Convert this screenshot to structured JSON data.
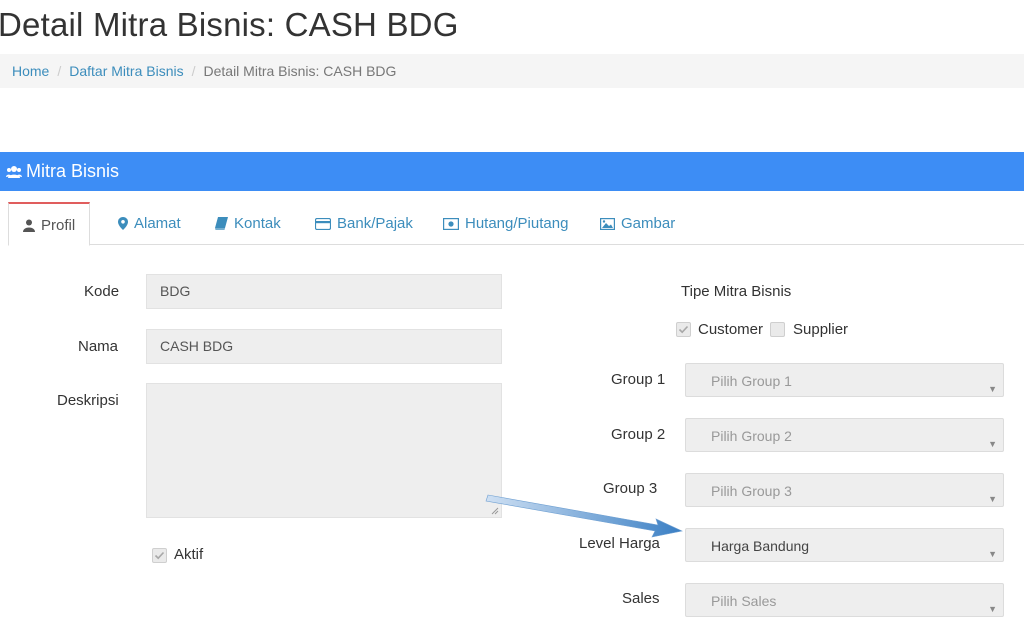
{
  "page": {
    "title": "Detail Mitra Bisnis: CASH BDG"
  },
  "breadcrumb": {
    "items": [
      {
        "label": "Home"
      },
      {
        "label": "Daftar Mitra Bisnis"
      },
      {
        "label": "Detail Mitra Bisnis: CASH BDG"
      }
    ],
    "separator": "/"
  },
  "panel": {
    "title": "Mitra Bisnis",
    "icon": "users-icon",
    "header_color": "#3d8df5"
  },
  "tabs": [
    {
      "label": "Profil",
      "icon": "user-icon",
      "active": true
    },
    {
      "label": "Alamat",
      "icon": "map-marker-icon",
      "active": false
    },
    {
      "label": "Kontak",
      "icon": "book-icon",
      "active": false
    },
    {
      "label": "Bank/Pajak",
      "icon": "credit-card-icon",
      "active": false
    },
    {
      "label": "Hutang/Piutang",
      "icon": "money-icon",
      "active": false
    },
    {
      "label": "Gambar",
      "icon": "image-icon",
      "active": false
    }
  ],
  "form": {
    "kode": {
      "label": "Kode",
      "value": "BDG"
    },
    "nama": {
      "label": "Nama",
      "value": "CASH BDG"
    },
    "deskripsi": {
      "label": "Deskripsi",
      "value": ""
    },
    "aktif": {
      "label": "Aktif",
      "checked": true
    },
    "tipe": {
      "label": "Tipe Mitra Bisnis",
      "customer": {
        "label": "Customer",
        "checked": true
      },
      "supplier": {
        "label": "Supplier",
        "checked": false
      }
    },
    "group1": {
      "label": "Group 1",
      "placeholder": "Pilih Group 1",
      "value": ""
    },
    "group2": {
      "label": "Group 2",
      "placeholder": "Pilih Group 2",
      "value": ""
    },
    "group3": {
      "label": "Group 3",
      "placeholder": "Pilih Group 3",
      "value": ""
    },
    "level_harga": {
      "label": "Level Harga",
      "placeholder": "",
      "value": "Harga Bandung"
    },
    "sales": {
      "label": "Sales",
      "placeholder": "Pilih Sales",
      "value": ""
    }
  },
  "colors": {
    "link": "#3c8dbc",
    "active_tab_border": "#e05d5d",
    "annotation_arrow": "#3a7fc4"
  }
}
